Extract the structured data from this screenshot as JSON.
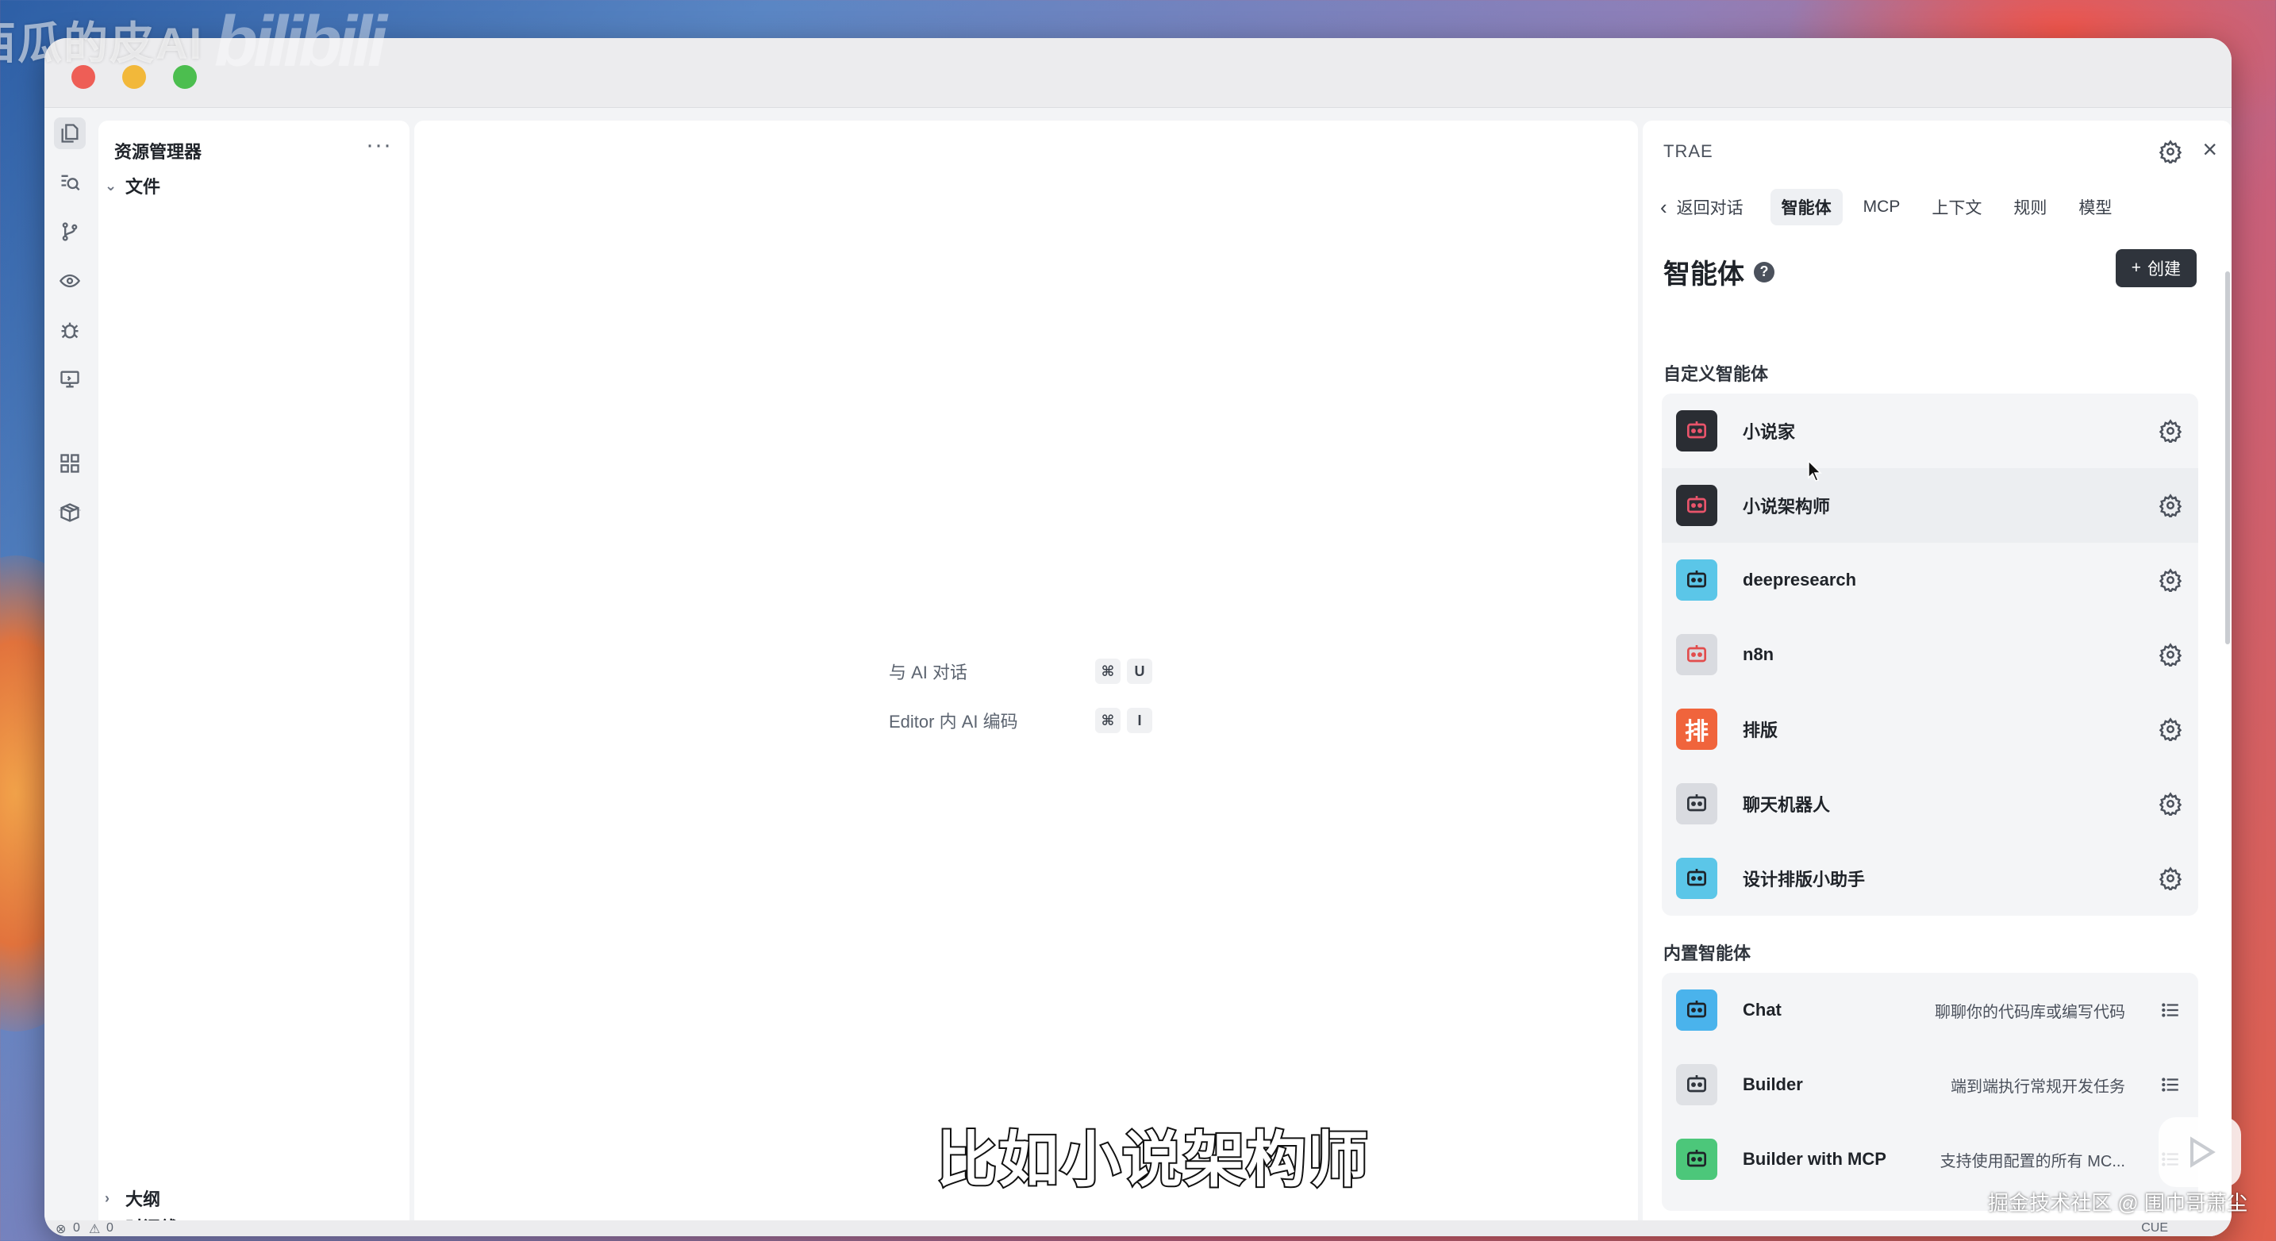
{
  "overlay": {
    "channel_text": "西瓜的皮AI",
    "bilibili_logo": "bilibili",
    "subtitle": "比如小说架构师",
    "watermark": "掘金技术社区 @ 围巾哥萧尘"
  },
  "activity_bar": {
    "icons": [
      "files-icon",
      "search-icon",
      "source-control-icon",
      "eye-icon",
      "bug-icon",
      "remote-icon",
      "extensions-icon",
      "package-icon"
    ]
  },
  "explorer": {
    "title": "资源管理器",
    "more": "···",
    "root_folder": "文件",
    "outline": "大纲",
    "timeline": "时间线"
  },
  "editor": {
    "shortcuts": [
      {
        "label": "与 AI 对话",
        "keys": [
          "⌘",
          "U"
        ]
      },
      {
        "label": "Editor 内 AI 编码",
        "keys": [
          "⌘",
          "I"
        ]
      }
    ]
  },
  "panel": {
    "brand": "TRAE",
    "back": "返回对话",
    "tabs": [
      "智能体",
      "MCP",
      "上下文",
      "规则",
      "模型"
    ],
    "active_tab": "智能体",
    "heading": "智能体",
    "help": "?",
    "create_button": "创建",
    "custom_section": "自定义智能体",
    "custom_agents": [
      {
        "name": "小说家",
        "icon_color": "#2a2d33",
        "icon_accent": "#e9546b"
      },
      {
        "name": "小说架构师",
        "icon_color": "#2a2d33",
        "icon_accent": "#e9546b"
      },
      {
        "name": "deepresearch",
        "icon_color": "#5bc6e8",
        "icon_accent": "#1f2329"
      },
      {
        "name": "n8n",
        "icon_color": "#d9dbe0",
        "icon_accent": "#e24d4d"
      },
      {
        "name": "排版",
        "icon_color": "#f0643c",
        "icon_accent": "#ffffff",
        "glyph": "排"
      },
      {
        "name": "聊天机器人",
        "icon_color": "#d9dbe0",
        "icon_accent": "#2f343c"
      },
      {
        "name": "设计排版小助手",
        "icon_color": "#5bc6e8",
        "icon_accent": "#1f2329"
      }
    ],
    "builtin_section": "内置智能体",
    "builtin_agents": [
      {
        "name": "Chat",
        "desc": "聊聊你的代码库或编写代码",
        "icon_color": "#4ab3ec",
        "icon_accent": "#1f2329"
      },
      {
        "name": "Builder",
        "desc": "端到端执行常规开发任务",
        "icon_color": "#dfe1e5",
        "icon_accent": "#2f343c"
      },
      {
        "name": "Builder with MCP",
        "desc": "支持使用配置的所有 MC...",
        "icon_color": "#4cc77a",
        "icon_accent": "#1f2329"
      }
    ]
  },
  "statusbar": {
    "errors": "0",
    "warnings": "0",
    "right_text": "CUE"
  }
}
